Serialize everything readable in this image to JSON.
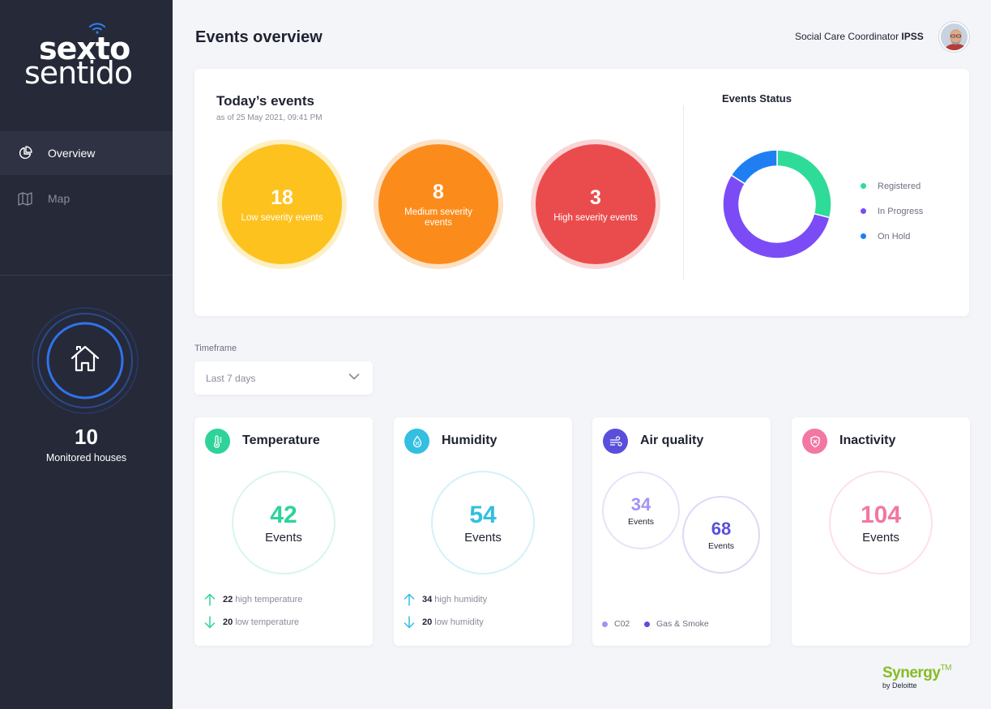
{
  "brand": {
    "logo_top": "sexto",
    "logo_bottom": "sentido"
  },
  "nav": {
    "items": [
      {
        "label": "Overview",
        "icon": "pie-chart-icon",
        "active": true
      },
      {
        "label": "Map",
        "icon": "map-icon",
        "active": false
      }
    ]
  },
  "monitored": {
    "count": "10",
    "label": "Monitored houses",
    "icon": "house-icon"
  },
  "header": {
    "title": "Events overview",
    "user_role": "Social Care Coordinator",
    "user_org": "IPSS"
  },
  "today": {
    "title": "Today’s events",
    "subtitle": "as of 25 May 2021, 09:41 PM",
    "severity": [
      {
        "count": "18",
        "label": "Low severity events",
        "color": "#fdc21d"
      },
      {
        "count": "8",
        "label": "Medium severity events",
        "color": "#fb8c1c"
      },
      {
        "count": "3",
        "label": "High severity events",
        "color": "#ea4c4d"
      }
    ]
  },
  "status": {
    "title": "Events Status",
    "legend": [
      {
        "label": "Registered",
        "color": "#2edb98"
      },
      {
        "label": "In Progress",
        "color": "#7b4cf6"
      },
      {
        "label": "On Hold",
        "color": "#1f7ff2"
      }
    ]
  },
  "chart_data": {
    "type": "pie",
    "categories": [
      "Registered",
      "In Progress",
      "On Hold"
    ],
    "values": [
      29,
      55,
      16
    ],
    "title": "Events Status",
    "legend": "right",
    "colors": [
      "#2edb98",
      "#7b4cf6",
      "#1f7ff2"
    ]
  },
  "timeframe": {
    "label": "Timeframe",
    "value": "Last 7 days"
  },
  "metrics": {
    "temperature": {
      "title": "Temperature",
      "count": "42",
      "unit": "Events",
      "color": "#2ed39a",
      "up_count": "22",
      "up_label": "high temperature",
      "down_count": "20",
      "down_label": "low temperature"
    },
    "humidity": {
      "title": "Humidity",
      "count": "54",
      "unit": "Events",
      "color": "#32bfe0",
      "up_count": "34",
      "up_label": "high humidity",
      "down_count": "20",
      "down_label": "low humidity"
    },
    "air": {
      "title": "Air quality",
      "co2_count": "34",
      "gas_count": "68",
      "unit": "Events",
      "co2_label": "C02",
      "gas_label": "Gas & Smoke",
      "co2_color": "#a393f3",
      "gas_color": "#5a4fdb"
    },
    "inactivity": {
      "title": "Inactivity",
      "count": "104",
      "unit": "Events",
      "color": "#f277a2"
    }
  },
  "footer": {
    "synergy": "Synergy",
    "tm": "TM",
    "by": "by Deloitte"
  }
}
